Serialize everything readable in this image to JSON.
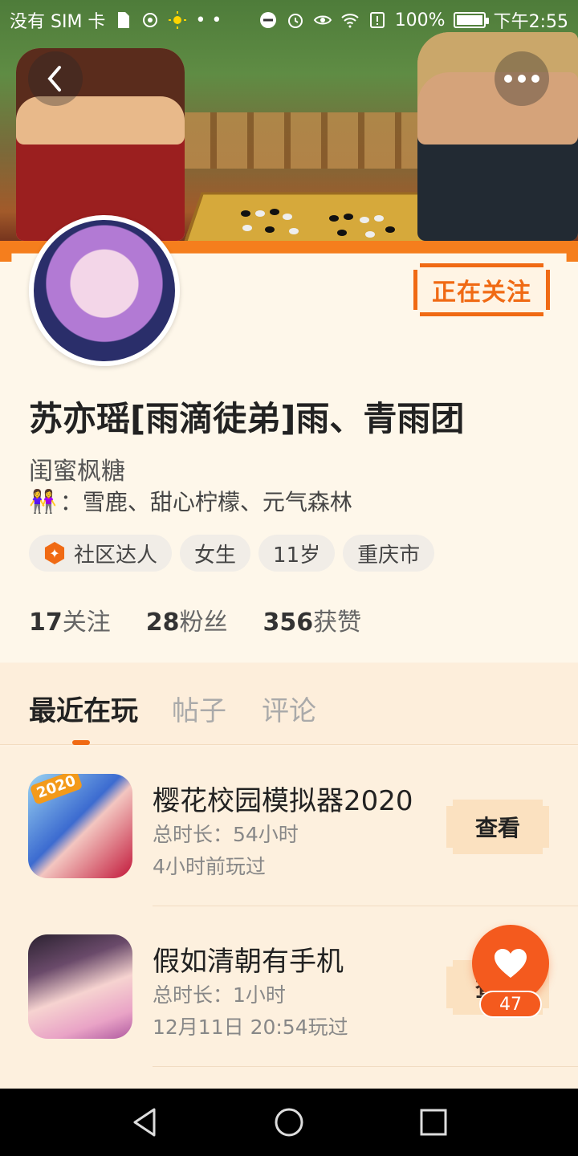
{
  "status_bar": {
    "carrier": "没有 SIM 卡",
    "battery_percent": "100%",
    "time": "下午2:55",
    "battery_level": 1.0
  },
  "header": {
    "back_icon": "chevron-left-icon",
    "more_icon": "more-dots-icon"
  },
  "profile": {
    "name": "苏亦瑶[雨滴徒弟]雨、青雨团",
    "subtitle": "闺蜜枫糖",
    "friends_emoji": "👭",
    "friends_text": "：雪鹿、甜心柠檬、元气森林",
    "follow_label": "正在关注",
    "tags": [
      {
        "label": "社区达人",
        "icon": "community-expert-icon"
      },
      {
        "label": "女生"
      },
      {
        "label": "11岁"
      },
      {
        "label": "重庆市"
      }
    ],
    "stats": [
      {
        "num": "17",
        "label": "关注"
      },
      {
        "num": "28",
        "label": "粉丝"
      },
      {
        "num": "356",
        "label": "获赞"
      }
    ]
  },
  "tabs": [
    {
      "label": "最近在玩",
      "active": true
    },
    {
      "label": "帖子",
      "active": false
    },
    {
      "label": "评论",
      "active": false
    }
  ],
  "games": [
    {
      "title": "樱花校园模拟器2020",
      "duration": "总时长：54小时",
      "last_played": "4小时前玩过",
      "button": "查看",
      "icon_badge": "2020"
    },
    {
      "title": "假如清朝有手机",
      "duration": "总时长：1小时",
      "last_played": "12月11日 20:54玩过",
      "button": "查看"
    }
  ],
  "like": {
    "count": "47",
    "icon": "heart-icon"
  },
  "colors": {
    "accent": "#f06a14",
    "background": "#fdf2e2",
    "like": "#f45a1e"
  }
}
